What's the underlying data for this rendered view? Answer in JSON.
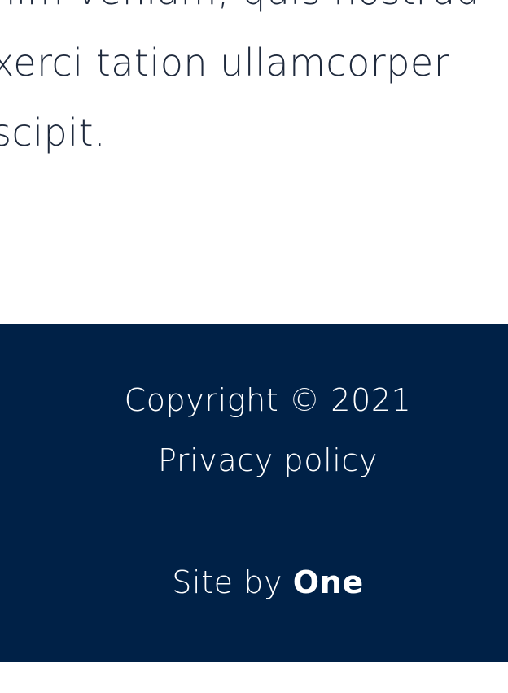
{
  "article": {
    "lines": [
      "nim veniam, quis nostrud",
      "xerci tation ullamcorper",
      "scipit."
    ]
  },
  "footer": {
    "copyright": "Copyright © 2021",
    "privacy_link": "Privacy policy",
    "site_by_prefix": "Site by ",
    "site_by_brand": "One"
  },
  "colors": {
    "footer_background": "#002147",
    "footer_text": "#ffffff",
    "body_text": "#1f2a3d"
  }
}
